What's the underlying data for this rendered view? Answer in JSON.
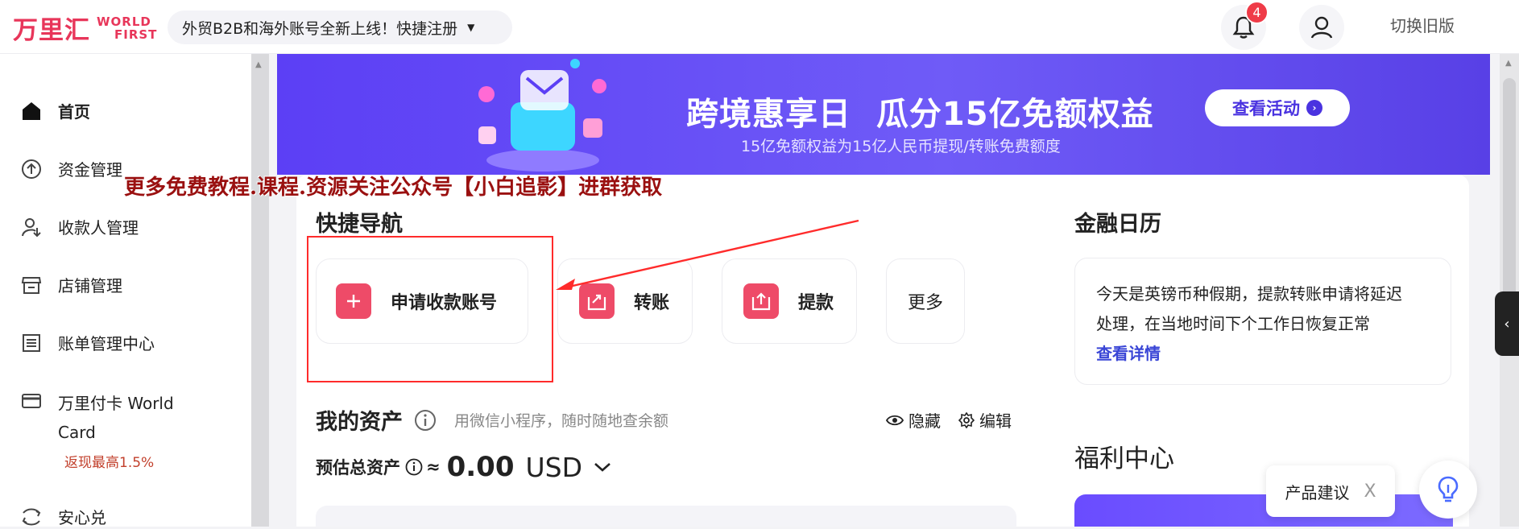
{
  "header": {
    "logo_cn": "万里汇",
    "logo_en_line1": "WORLD",
    "logo_en_line2": "FIRST",
    "announcement": "外贸B2B和海外账号全新上线！快捷注册",
    "notification_count": "4",
    "switch_old_version": "切换旧版"
  },
  "sidebar": {
    "items": [
      {
        "label": "首页",
        "icon": "home-icon"
      },
      {
        "label": "资金管理",
        "icon": "fund-icon"
      },
      {
        "label": "收款人管理",
        "icon": "payee-icon"
      },
      {
        "label": "店铺管理",
        "icon": "store-icon"
      },
      {
        "label": "账单管理中心",
        "icon": "bill-icon"
      },
      {
        "label": "万里付卡 World",
        "label_line2": "Card",
        "sub": "返现最高1.5%",
        "icon": "card-icon"
      },
      {
        "label": "安心兑",
        "icon": "exchange-icon"
      }
    ]
  },
  "banner": {
    "title_part1": "跨境惠享日",
    "title_part2": "瓜分15亿免额权益",
    "subtitle": "15亿免额权益为15亿人民币提现/转账免费额度",
    "button": "查看活动"
  },
  "watermark": "更多免费教程.课程.资源关注公众号【小白追影】进群获取",
  "quick_nav": {
    "title": "快捷导航",
    "items": [
      {
        "label": "申请收款账号",
        "icon": "plus-icon"
      },
      {
        "label": "转账",
        "icon": "transfer-icon"
      },
      {
        "label": "提款",
        "icon": "withdraw-icon"
      },
      {
        "label": "更多"
      }
    ]
  },
  "assets": {
    "title": "我的资产",
    "hint": "用微信小程序，随时随地查余额",
    "hide_label": "隐藏",
    "edit_label": "编辑",
    "total_label": "预估总资产",
    "approx": "≈",
    "amount": "0.00",
    "currency": "USD"
  },
  "finance_calendar": {
    "title": "金融日历",
    "text_line1": "今天是英镑币种假期，提款转账申请将延迟",
    "text_line2": "处理，在当地时间下个工作日恢复正常",
    "link": "查看详情"
  },
  "welfare": {
    "title": "福利中心"
  },
  "feedback": {
    "label": "产品建议",
    "close": "X"
  },
  "colors": {
    "brand": "#e8365a",
    "banner": "#5c3ff5",
    "link": "#3a46d6",
    "highlight": "#ff2b2b"
  }
}
